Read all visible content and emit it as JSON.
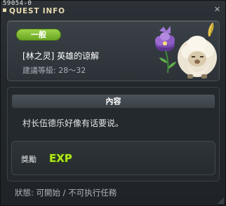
{
  "window": {
    "quest_id": "59054-0",
    "title": "QUEST INFO",
    "close_icon": "close-x-icon"
  },
  "quest": {
    "category": "一般",
    "category_color": "#8cc63f",
    "name": "[林之灵] 英雄的谅解",
    "recommended_level": "建議等級: 28～32"
  },
  "content": {
    "header": "內容",
    "text": "村长伍德乐好像有话要说。"
  },
  "reward": {
    "label": "獎勵",
    "items": [
      {
        "type": "EXP",
        "icon": "exp-icon"
      }
    ]
  },
  "status": {
    "text": "狀態: 可開始 / 不可执行任務"
  },
  "colors": {
    "window_bg": "#23282c",
    "title_color": "#e8d9b0",
    "badge_green": "#8cc63f",
    "exp_green": "#b6e31c"
  }
}
